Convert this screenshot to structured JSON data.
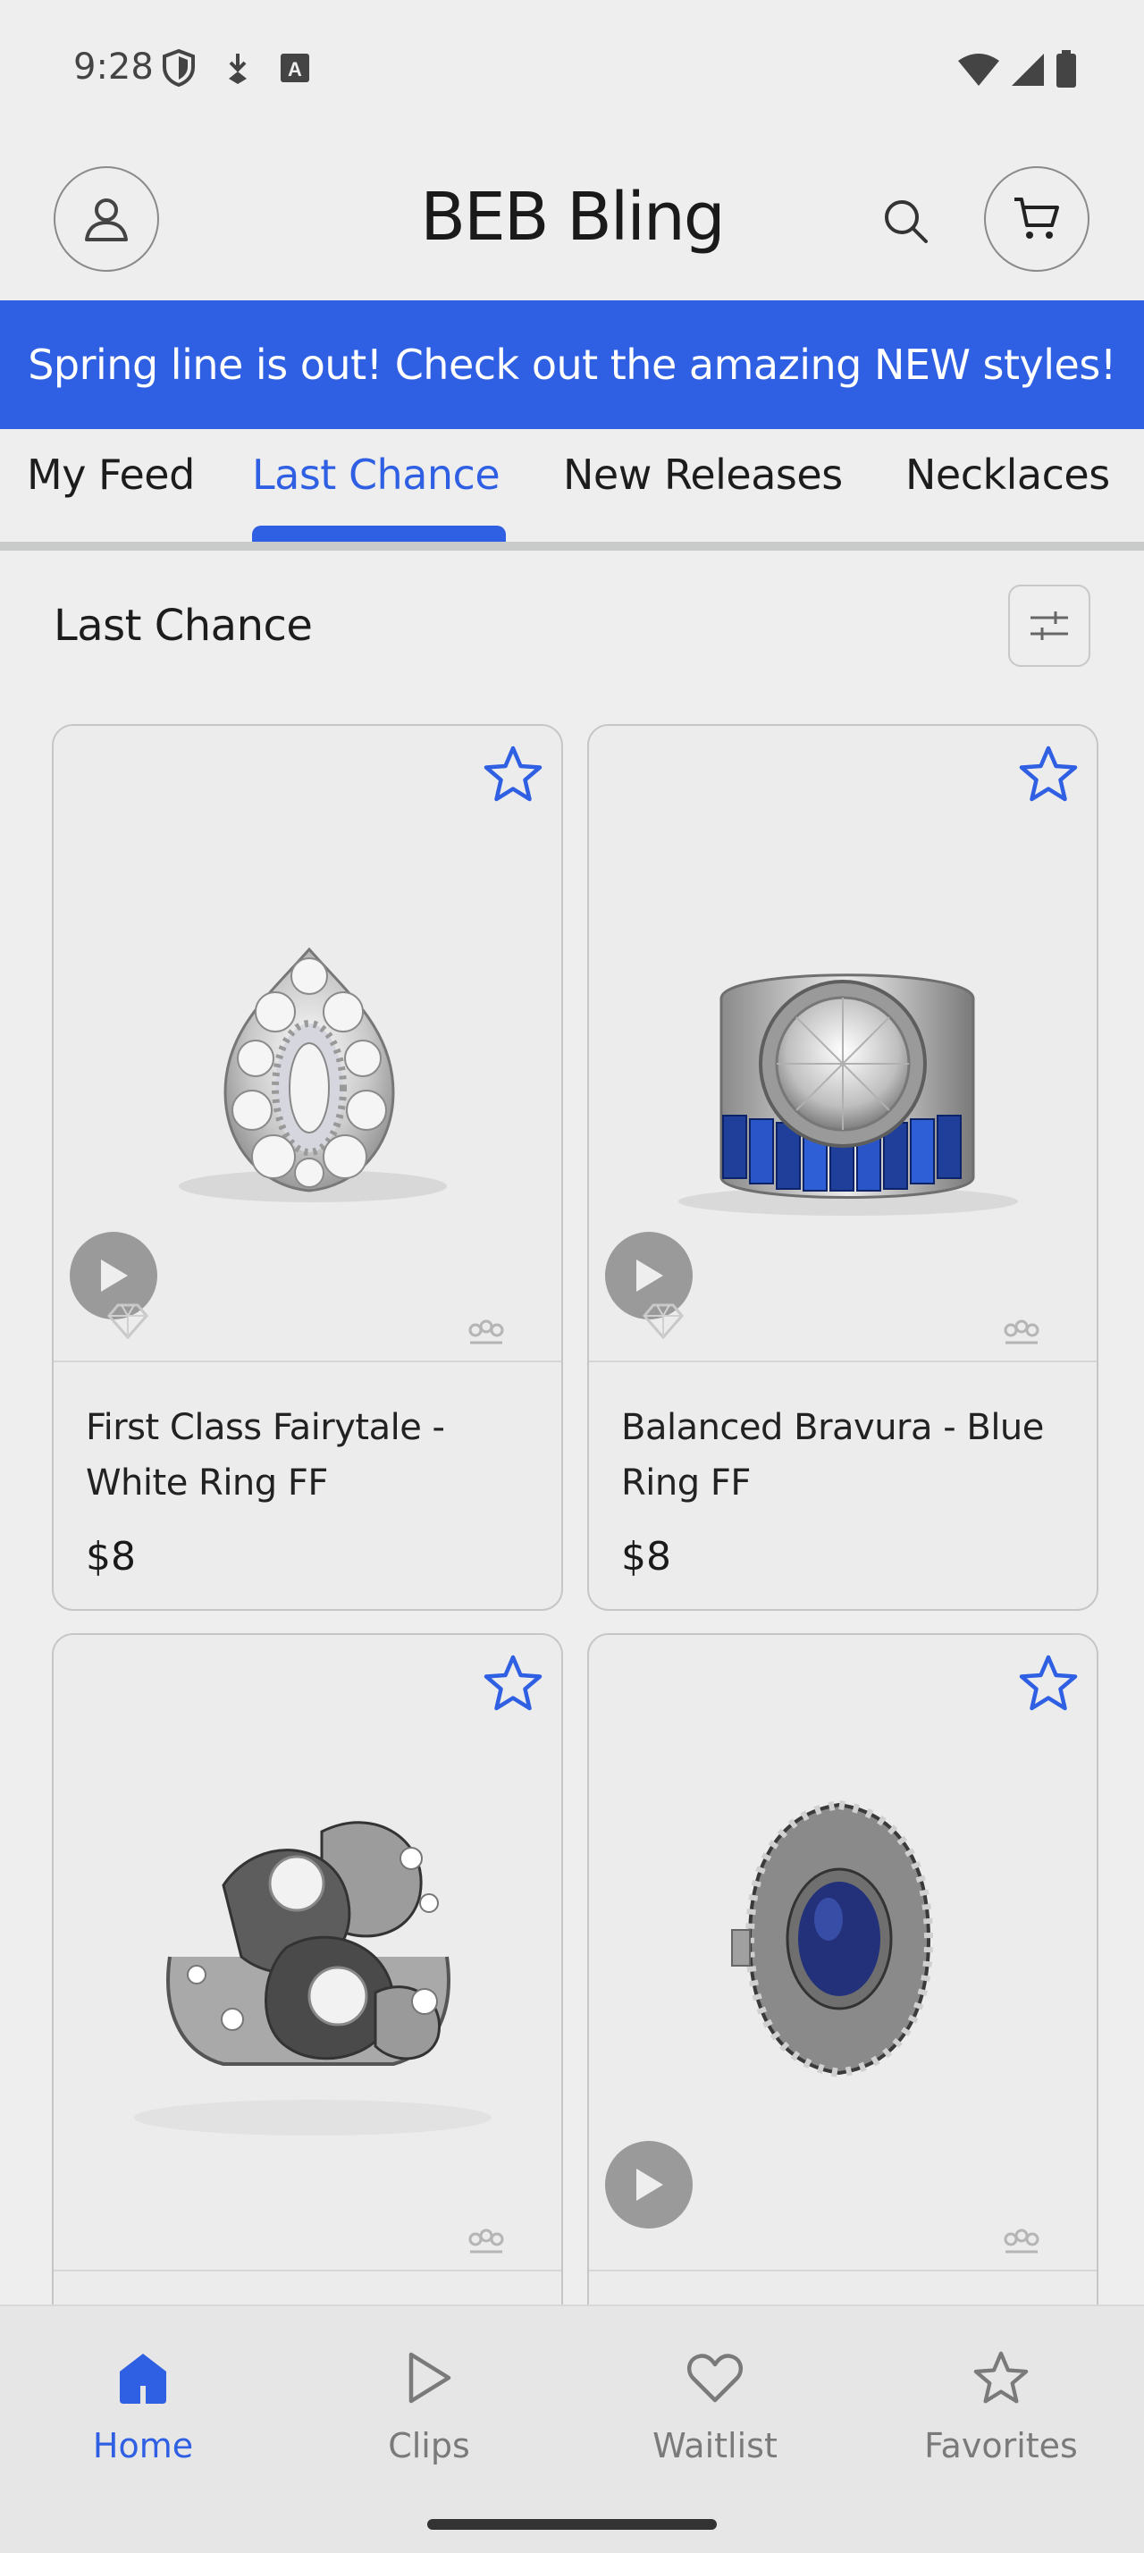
{
  "status_bar": {
    "time": "9:28"
  },
  "header": {
    "title": "BEB Bling"
  },
  "banner": {
    "text": "Spring line is out! Check out the amazing NEW styles!"
  },
  "tabs": [
    {
      "label": "My Feed",
      "active": false
    },
    {
      "label": "Last Chance",
      "active": true
    },
    {
      "label": "New Releases",
      "active": false
    },
    {
      "label": "Necklaces",
      "active": false
    }
  ],
  "section": {
    "title": "Last Chance"
  },
  "products": [
    {
      "name": "First Class Fairytale - White Ring FF",
      "price": "$8",
      "has_video": true,
      "favorited": false
    },
    {
      "name": "Balanced Bravura - Blue Ring FF",
      "price": "$8",
      "has_video": true,
      "favorited": false
    },
    {
      "name": "",
      "price": "",
      "has_video": false,
      "favorited": false
    },
    {
      "name": "",
      "price": "",
      "has_video": true,
      "favorited": false
    }
  ],
  "bottom_nav": [
    {
      "label": "Home",
      "icon": "home-icon",
      "active": true
    },
    {
      "label": "Clips",
      "icon": "play-icon",
      "active": false
    },
    {
      "label": "Waitlist",
      "icon": "heart-icon",
      "active": false
    },
    {
      "label": "Favorites",
      "icon": "star-icon",
      "active": false
    }
  ],
  "colors": {
    "accent": "#2f5fe3",
    "background": "#eeeeee",
    "inactive_text": "#7a7a7a"
  }
}
